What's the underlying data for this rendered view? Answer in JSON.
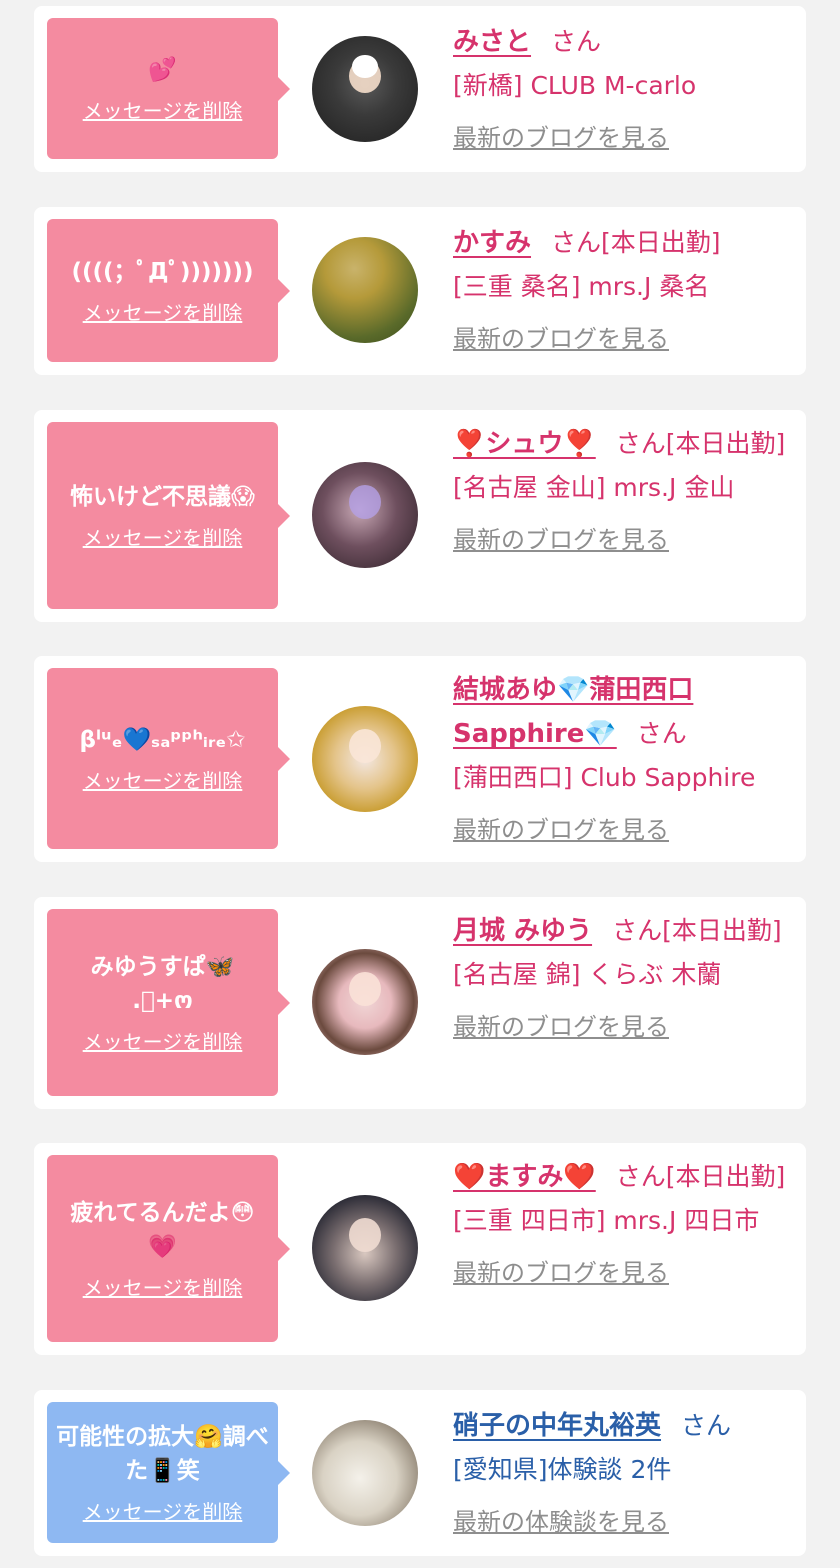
{
  "colors": {
    "pink_bubble": "#f48ba0",
    "blue_bubble": "#8eb8f2",
    "pink_text": "#d6336c",
    "blue_text": "#2a5fa8",
    "gray_link": "#8e8e8e"
  },
  "delete_label": "メッセージを削除",
  "honorific": "さん",
  "items": [
    {
      "message": "💕",
      "name": "みさと",
      "status": "",
      "shop": "[新橋] CLUB M-carlo",
      "link": "最新のブログを見る",
      "avatar_icon": "avatar-photo-icon"
    },
    {
      "message": "((((；ﾟДﾟ)))))))",
      "name": "かすみ",
      "status": "[本日出勤]",
      "shop": "[三重 桑名] mrs.J 桑名",
      "link": "最新のブログを見る",
      "avatar_icon": "avatar-photo-icon"
    },
    {
      "message": "怖いけど不思議😱",
      "name": "❣️シュウ❣️",
      "status": "[本日出勤]",
      "shop": "[名古屋 金山] mrs.J 金山",
      "link": "最新のブログを見る",
      "avatar_icon": "avatar-photo-icon"
    },
    {
      "message": "βˡᵘₑ💙ₛₐᵖᵖʰᵢᵣₑ✩",
      "name": "結城あゆ💎蒲田西口Sapphire💎",
      "status": "",
      "shop": "[蒲田西口] Club Sapphire",
      "link": "最新のブログを見る",
      "avatar_icon": "avatar-photo-icon"
    },
    {
      "message": "みゆうすぱ🦋\n.ﾟ+ო",
      "name": "月城 みゆう",
      "status": "[本日出勤]",
      "shop": "[名古屋 錦] くらぶ 木蘭",
      "link": "最新のブログを見る",
      "avatar_icon": "avatar-photo-icon"
    },
    {
      "message": "疲れてるんだよ😳\n💗",
      "name": "❤️ますみ❤️",
      "status": "[本日出勤]",
      "shop": "[三重 四日市] mrs.J 四日市",
      "link": "最新のブログを見る",
      "avatar_icon": "avatar-photo-icon"
    },
    {
      "message": "可能性の拡大🤗調べた📱笑",
      "name": "硝子の中年丸裕英",
      "status": "",
      "shop": "[愛知県]体験談 2件",
      "link": "最新の体験談を見る",
      "avatar_icon": "avatar-photo-icon"
    }
  ]
}
